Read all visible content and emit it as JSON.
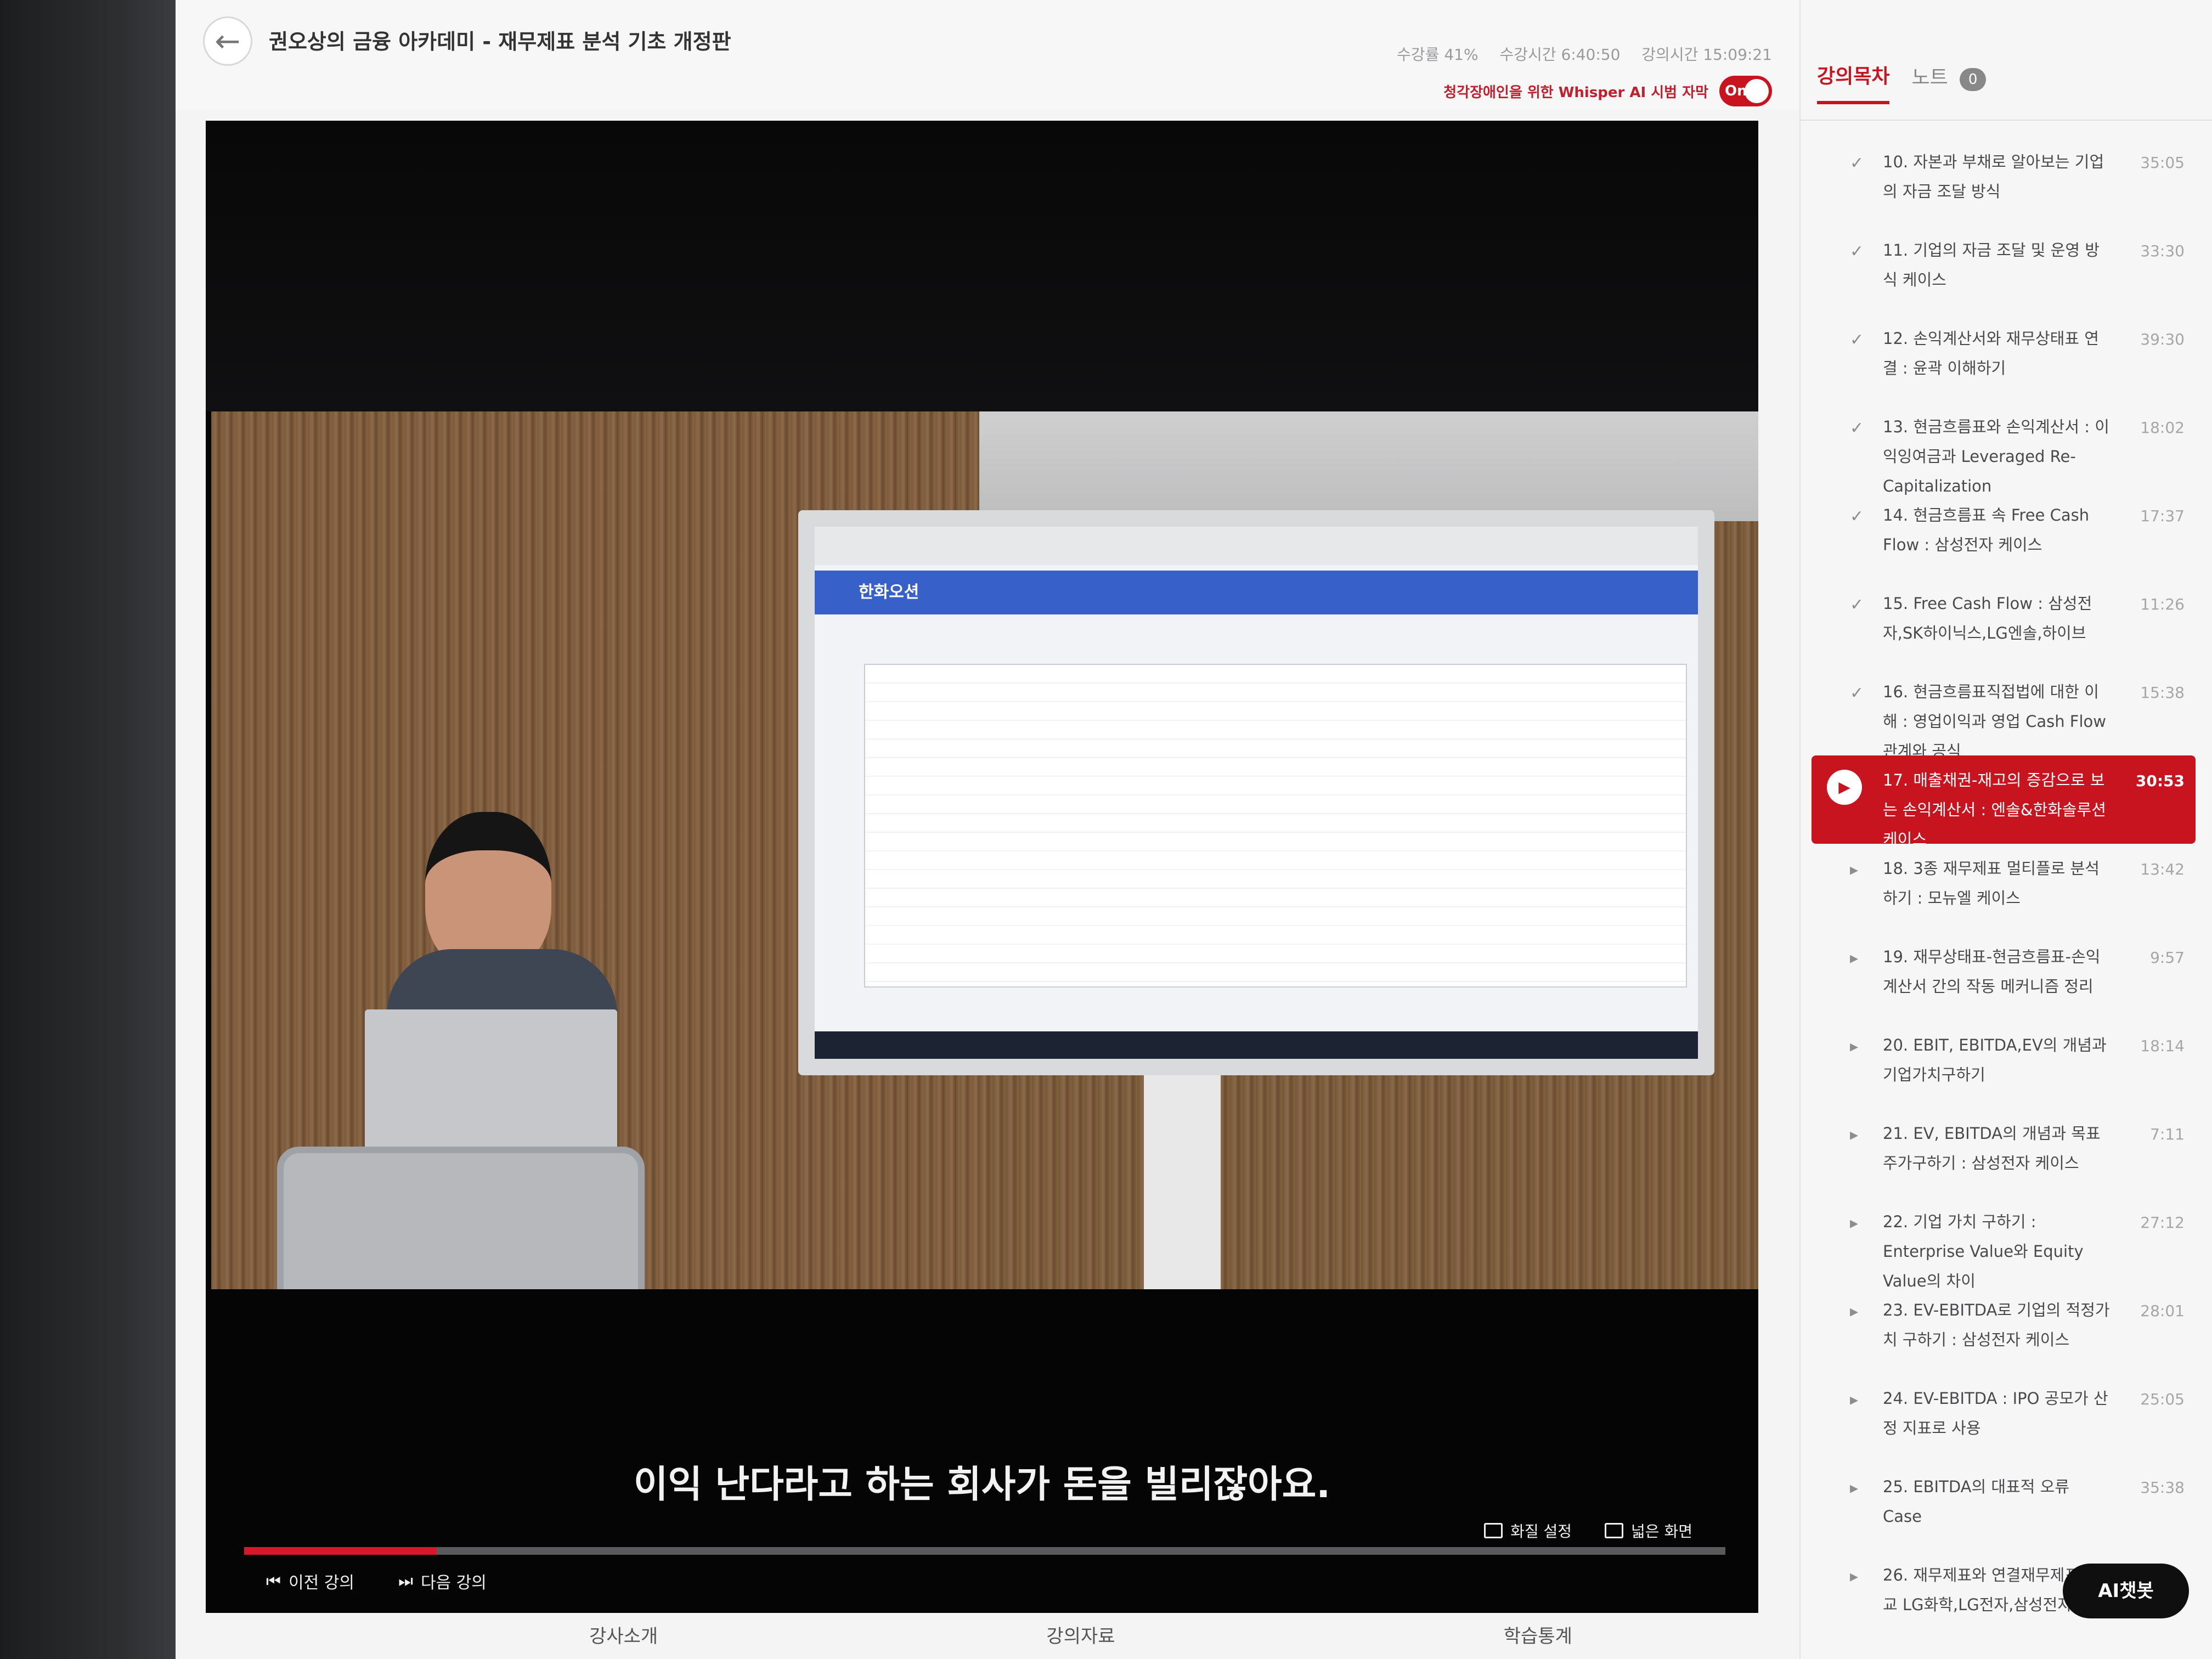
{
  "header": {
    "course_title": "권오상의 금융 아카데미 - 재무제표 분석 기초 개정판",
    "progress": "수강률 41%",
    "watch_time": "수강시간 6:40:50",
    "lecture_time": "강의시간 15:09:21",
    "caption_label": "청각장애인을 위한 Whisper AI 시범 자막",
    "caption_toggle": "On"
  },
  "video": {
    "screen_app_title": "한화오션",
    "subtitle": "이익 난다라고 하는 회사가 돈을 빌리잖아요.",
    "progress_fraction": 0.13,
    "quality_label": "화질 설정",
    "wide_label": "넓은 화면",
    "prev_label": "이전 강의",
    "next_label": "다음 강의"
  },
  "bottom_tabs": [
    "강사소개",
    "강의자료",
    "학습통계"
  ],
  "sidebar": {
    "tab_toc": "강의목차",
    "tab_note": "노트",
    "note_count": "0",
    "lectures": [
      {
        "title": "10. 자본과 부채로 알아보는 기업의 자금 조달 방식",
        "duration": "35:05",
        "mark": "✓"
      },
      {
        "title": "11. 기업의 자금 조달 및 운영 방식 케이스",
        "duration": "33:30",
        "mark": "✓"
      },
      {
        "title": "12. 손익계산서와 재무상태표 연결 : 윤곽 이해하기",
        "duration": "39:30",
        "mark": "✓"
      },
      {
        "title": "13. 현금흐름표와 손익계산서 : 이익잉여금과 Leveraged Re-Capitalization",
        "duration": "18:02",
        "mark": "✓"
      },
      {
        "title": "14. 현금흐름표 속 Free Cash Flow : 삼성전자 케이스",
        "duration": "17:37",
        "mark": "✓"
      },
      {
        "title": "15. Free Cash Flow : 삼성전자,SK하이닉스,LG엔솔,하이브",
        "duration": "11:26",
        "mark": "✓"
      },
      {
        "title": "16. 현금흐름표직접법에 대한 이해 : 영업이익과 영업 Cash Flow 관계와 공식",
        "duration": "15:38",
        "mark": "✓"
      },
      {
        "title": "17. 매출채권-재고의 증감으로 보는 손익계산서 : 엔솔&한화솔루션 케이스",
        "duration": "30:53",
        "mark": "▶",
        "current": true
      },
      {
        "title": "18. 3종 재무제표 멀티플로 분석하기 : 모뉴엘 케이스",
        "duration": "13:42",
        "mark": "▸"
      },
      {
        "title": "19. 재무상태표-현금흐름표-손익계산서 간의 작동 메커니즘 정리",
        "duration": "9:57",
        "mark": "▸"
      },
      {
        "title": "20. EBIT, EBITDA,EV의 개념과 기업가치구하기",
        "duration": "18:14",
        "mark": "▸"
      },
      {
        "title": "21. EV, EBITDA의 개념과 목표주가구하기 : 삼성전자 케이스",
        "duration": "7:11",
        "mark": "▸"
      },
      {
        "title": "22. 기업 가치 구하기 : Enterprise Value와 Equity Value의 차이",
        "duration": "27:12",
        "mark": "▸"
      },
      {
        "title": "23. EV-EBITDA로 기업의 적정가치 구하기 : 삼성전자 케이스",
        "duration": "28:01",
        "mark": "▸"
      },
      {
        "title": "24. EV-EBITDA : IPO 공모가 산정 지표로 사용",
        "duration": "25:05",
        "mark": "▸"
      },
      {
        "title": "25. EBITDA의 대표적 오류 Case",
        "duration": "35:38",
        "mark": "▸"
      },
      {
        "title": "26. 재무제표와 연결재무제표 비교 LG화학,LG전자,삼성전자",
        "duration": "",
        "mark": "▸"
      }
    ]
  },
  "ai_chat_label": "AI챗봇"
}
